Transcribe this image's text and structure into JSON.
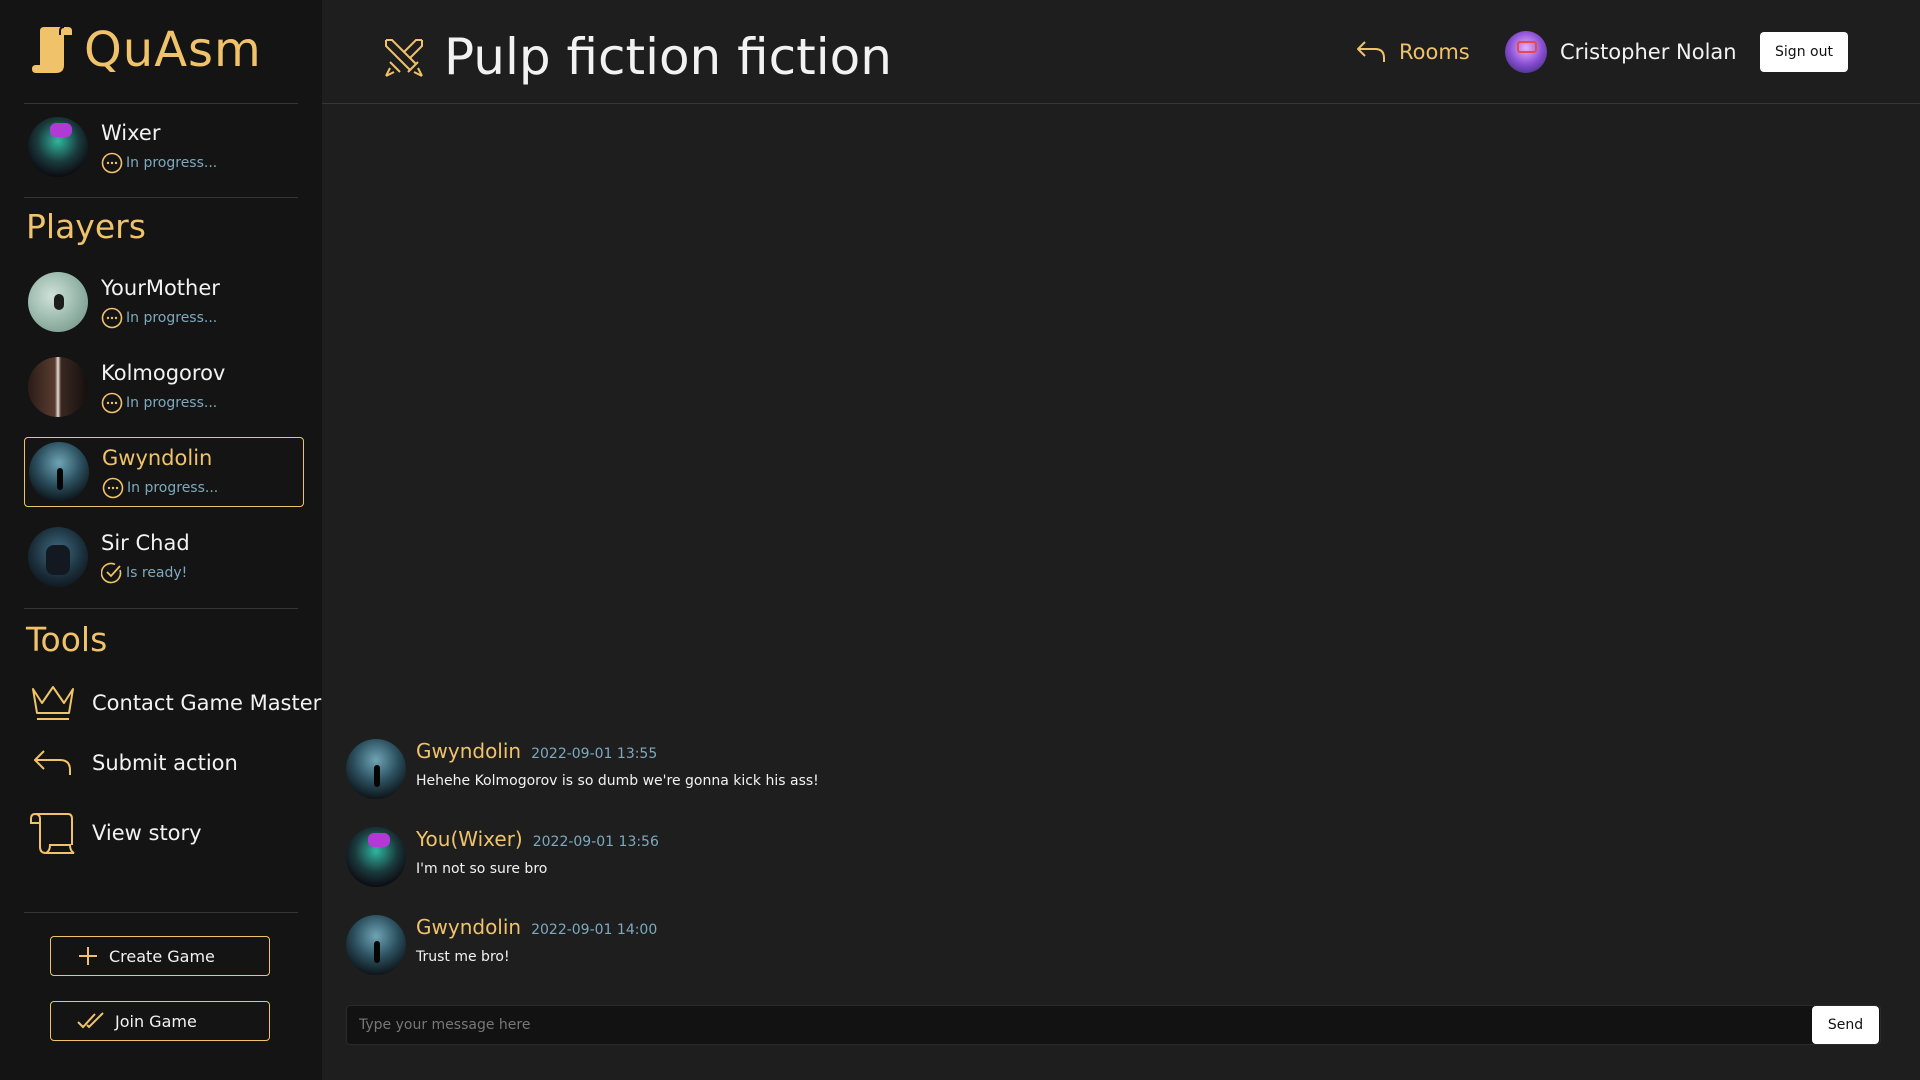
{
  "app": {
    "name": "QuAsm"
  },
  "current_player": {
    "name": "Wixer",
    "status": "In progress..."
  },
  "players_section": {
    "title": "Players",
    "players": [
      {
        "name": "YourMother",
        "status": "In progress..."
      },
      {
        "name": "Kolmogorov",
        "status": "In progress..."
      },
      {
        "name": "Gwyndolin",
        "status": "In progress..."
      },
      {
        "name": "Sir Chad",
        "status": "Is ready!"
      }
    ]
  },
  "tools_section": {
    "title": "Tools",
    "items": [
      {
        "label": "Contact Game Master",
        "icon": "crown-icon"
      },
      {
        "label": "Submit action",
        "icon": "reply-arrow-icon"
      },
      {
        "label": "View story",
        "icon": "scroll-icon"
      }
    ]
  },
  "actions": {
    "create_game": "Create Game",
    "join_game": "Join Game"
  },
  "header": {
    "room_title": "Pulp fiction fiction",
    "room_icon": "crossed-swords-icon",
    "rooms_label": "Rooms",
    "user_name": "Cristopher Nolan",
    "sign_out": "Sign out"
  },
  "chat": {
    "messages": [
      {
        "author": "Gwyndolin",
        "time": "2022-09-01 13:55",
        "text": "Hehehe Kolmogorov is so dumb we're gonna kick his ass!"
      },
      {
        "author": "You(Wixer)",
        "time": "2022-09-01 13:56",
        "text": "I'm not so sure bro"
      },
      {
        "author": "Gwyndolin",
        "time": "2022-09-01 14:00",
        "text": "Trust me bro!"
      }
    ],
    "input_placeholder": "Type your message here",
    "send_label": "Send"
  },
  "colors": {
    "accent": "#f0c36a",
    "status": "#7ea9bd",
    "sidebar_bg": "#141414",
    "main_bg": "#1e1e1e"
  }
}
